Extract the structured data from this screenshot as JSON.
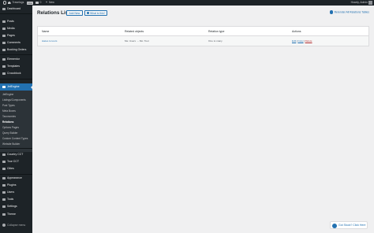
{
  "adminbar": {
    "site_name": "Travelogs",
    "site_badge": "Live",
    "comment_count": "0",
    "new_plus": "+",
    "new_label": "New",
    "howdy": "Howdy, Admin"
  },
  "sidebar": {
    "items": [
      {
        "label": "Dashboard",
        "icon": "dashboard-icon"
      },
      {
        "label": "Posts",
        "icon": "pin-icon"
      },
      {
        "label": "Media",
        "icon": "media-icon"
      },
      {
        "label": "Pages",
        "icon": "page-icon"
      },
      {
        "label": "Comments",
        "icon": "comment-icon"
      },
      {
        "label": "Booking Orders",
        "icon": "calendar-icon"
      },
      {
        "label": "Elementor",
        "icon": "elementor-icon"
      },
      {
        "label": "Templates",
        "icon": "folder-icon"
      },
      {
        "label": "Crocoblock",
        "icon": "crocoblock-icon"
      },
      {
        "label": "JetEngine",
        "icon": "jetengine-icon"
      },
      {
        "label": "Country CCT",
        "icon": "database-icon"
      },
      {
        "label": "Tour CCT",
        "icon": "database-icon"
      },
      {
        "label": "Cities",
        "icon": "pin-icon"
      },
      {
        "label": "Appearance",
        "icon": "brush-icon"
      },
      {
        "label": "Plugins",
        "icon": "plugin-icon"
      },
      {
        "label": "Users",
        "icon": "user-icon"
      },
      {
        "label": "Tools",
        "icon": "wrench-icon"
      },
      {
        "label": "Settings",
        "icon": "settings-icon"
      },
      {
        "label": "Theme",
        "icon": "theme-icon"
      }
    ],
    "active": "JetEngine",
    "submenu": [
      "JetEngine",
      "Listings/Components",
      "Post Types",
      "Meta Boxes",
      "Taxonomies",
      "Relations",
      "Options Pages",
      "Query Builder",
      "Custom Content Types",
      "Website Builder"
    ],
    "submenu_current": "Relations",
    "collapse": "Collapse menu"
  },
  "main": {
    "title": "Relations List",
    "add_new": "Add New",
    "what_is_this": "What is this?",
    "rerender": "Rerender All Relations Tables"
  },
  "table": {
    "headers": [
      "Name",
      "Related objects",
      "Relation type",
      "Actions"
    ],
    "rows": [
      {
        "name": "states to tours",
        "objects": "Me: Users → Mo: Tour",
        "type": "One to many",
        "actions": [
          "Edit",
          "Copy",
          "Delete"
        ]
      }
    ]
  },
  "help": {
    "label": "Got Stuck? Click Here"
  },
  "colors": {
    "accent": "#2271b1",
    "sidebar": "#1d2327",
    "delete": "#b32d2e"
  }
}
